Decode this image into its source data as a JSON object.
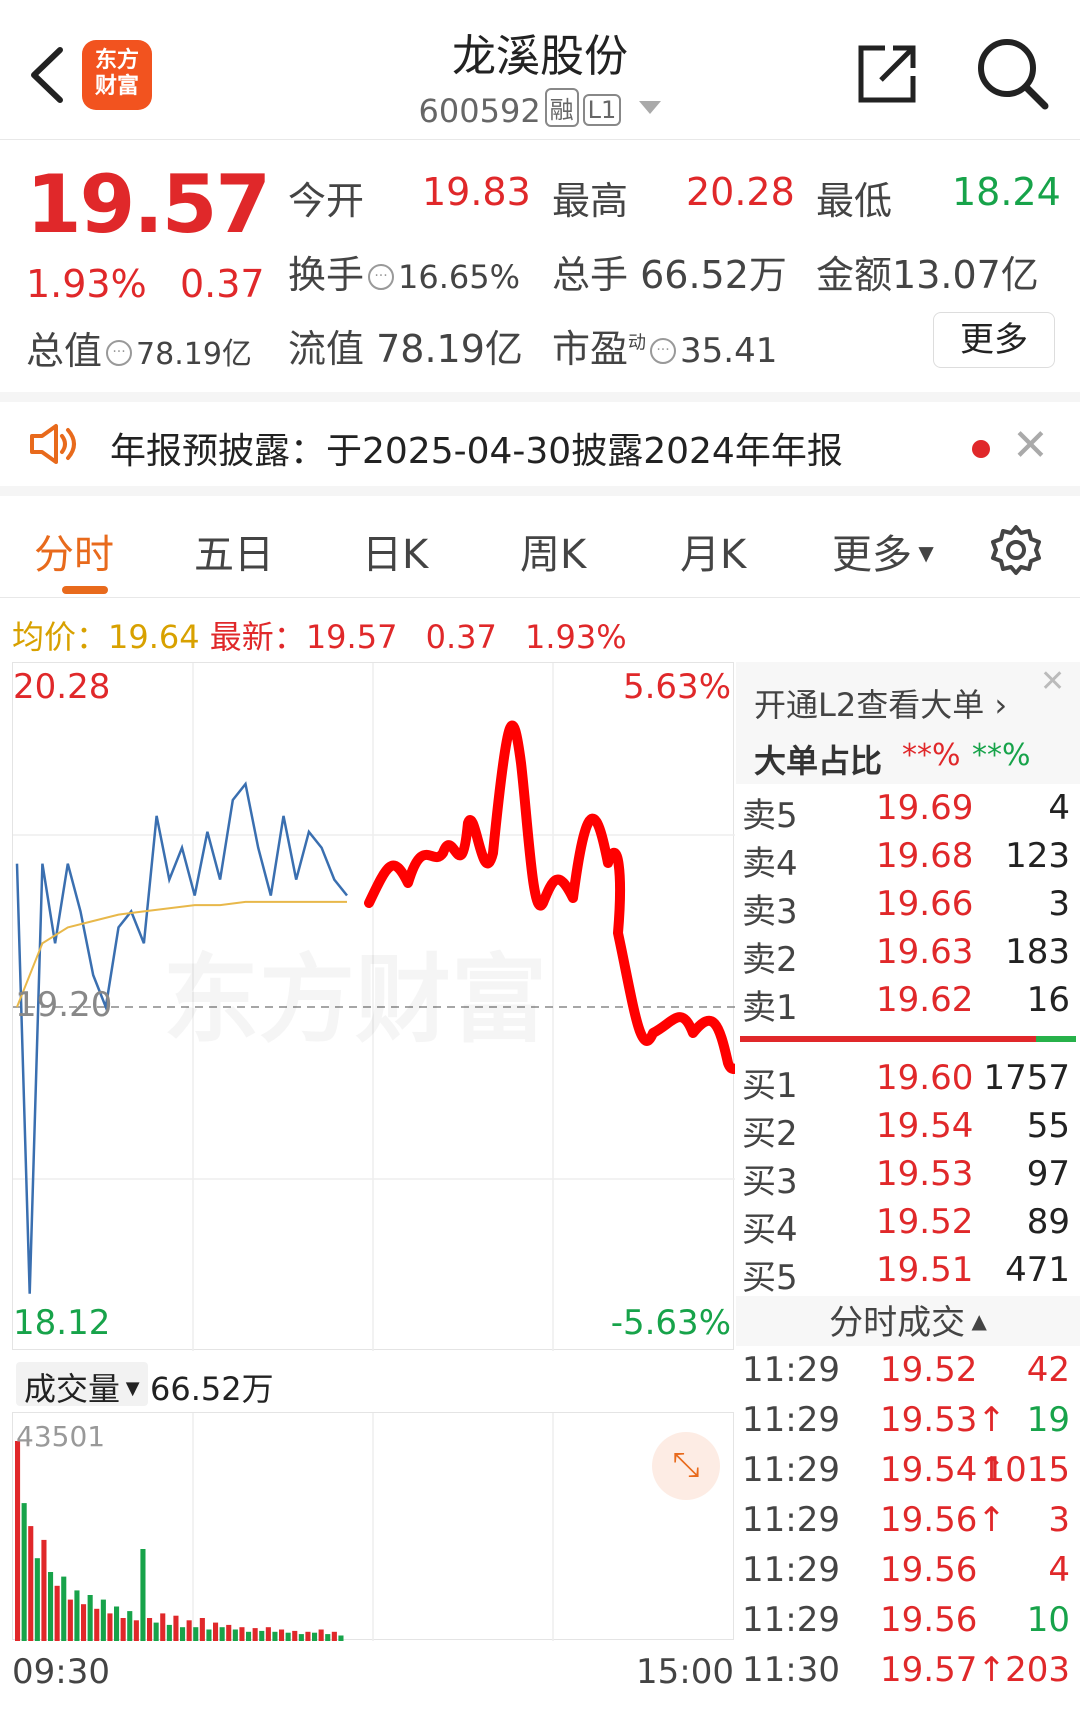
{
  "header": {
    "logo_text": "东方财富",
    "title": "龙溪股份",
    "code": "600592",
    "tag_margin": "融",
    "tag_level": "L1"
  },
  "quote": {
    "price": "19.57",
    "change_pct": "1.93%",
    "change_amt": "0.37",
    "open_label": "今开",
    "open": "19.83",
    "high_label": "最高",
    "high": "20.28",
    "low_label": "最低",
    "low": "18.24",
    "turnover_label": "换手",
    "turnover": "16.65%",
    "volume_label": "总手",
    "volume": "66.52万",
    "amount_label": "金额",
    "amount": "13.07亿",
    "mktcap_label": "总值",
    "mktcap": "78.19亿",
    "float_label": "流值",
    "float": "78.19亿",
    "pe_label": "市盈",
    "pe_sup": "动",
    "pe": "35.41",
    "more": "更多"
  },
  "notice": {
    "text": "年报预披露：于2025-04-30披露2024年年报"
  },
  "tabs": [
    "分时",
    "五日",
    "日K",
    "周K",
    "月K",
    "更多"
  ],
  "avg_row": {
    "avg_label": "均价：",
    "avg": "19.64",
    "latest_label": "最新：",
    "latest": "19.57",
    "chg": "0.37",
    "pct": "1.93%"
  },
  "chart": {
    "y_max": "20.28",
    "y_mid": "19.20",
    "y_min": "18.12",
    "pct_max": "5.63%",
    "pct_min": "-5.63%",
    "vol_label": "成交量",
    "vol_total": "66.52万",
    "vol_max": "43501",
    "t_start": "09:30",
    "t_end": "15:00",
    "watermark": "东方财富"
  },
  "chart_data": {
    "type": "line",
    "title": "",
    "xlabel": "",
    "ylabel": "",
    "ylim": [
      18.12,
      20.28
    ],
    "x_range": [
      "09:30",
      "15:00"
    ],
    "series": [
      {
        "values": [
          19.65,
          18.3,
          19.65,
          19.4,
          19.65,
          19.5,
          19.3,
          19.2,
          19.45,
          19.5,
          19.4,
          19.8,
          19.6,
          19.7,
          19.55,
          19.75,
          19.6,
          19.85,
          19.9,
          19.7,
          19.55,
          19.8,
          19.6,
          19.75,
          19.7,
          19.6,
          19.55
        ]
      },
      {
        "values": [
          19.2,
          19.4,
          19.45,
          19.47,
          19.49,
          19.5,
          19.51,
          19.52,
          19.52,
          19.53,
          19.53,
          19.53,
          19.53,
          19.53
        ]
      }
    ],
    "volume_bars": [
      43501,
      30000,
      25000,
      18000,
      22000,
      15000,
      12000,
      14000,
      9000,
      11000,
      8000,
      10000,
      7000,
      9000,
      6000,
      7500,
      5000,
      6500,
      4500,
      20000,
      5000,
      4000,
      6000,
      3500,
      5500,
      3000,
      4500,
      3000,
      5000,
      2500,
      4000,
      3000,
      3500,
      2500,
      3000,
      2000,
      2800,
      2200,
      3000,
      2000,
      2500,
      1800,
      2200,
      1500,
      2000,
      1800,
      2500,
      1500,
      2000,
      1200
    ]
  },
  "orderbook": {
    "l2_link": "开通L2查看大单",
    "big_order_label": "大单占比",
    "big_order_red": "**%",
    "big_order_green": "**%",
    "asks": [
      {
        "label": "卖5",
        "price": "19.69",
        "vol": "4"
      },
      {
        "label": "卖4",
        "price": "19.68",
        "vol": "123"
      },
      {
        "label": "卖3",
        "price": "19.66",
        "vol": "3"
      },
      {
        "label": "卖2",
        "price": "19.63",
        "vol": "183"
      },
      {
        "label": "卖1",
        "price": "19.62",
        "vol": "16"
      }
    ],
    "bids": [
      {
        "label": "买1",
        "price": "19.60",
        "vol": "1757"
      },
      {
        "label": "买2",
        "price": "19.54",
        "vol": "55"
      },
      {
        "label": "买3",
        "price": "19.53",
        "vol": "97"
      },
      {
        "label": "买4",
        "price": "19.52",
        "vol": "89"
      },
      {
        "label": "买5",
        "price": "19.51",
        "vol": "471"
      }
    ]
  },
  "ticks": {
    "header": "分时成交",
    "rows": [
      {
        "time": "11:29",
        "price": "19.52",
        "arrow": "",
        "vol": "42",
        "color": "#e0282a"
      },
      {
        "time": "11:29",
        "price": "19.53",
        "arrow": "↑",
        "vol": "19",
        "color": "#17a34a"
      },
      {
        "time": "11:29",
        "price": "19.54",
        "arrow": "↑",
        "vol": "1015",
        "color": "#e0282a"
      },
      {
        "time": "11:29",
        "price": "19.56",
        "arrow": "↑",
        "vol": "3",
        "color": "#e0282a"
      },
      {
        "time": "11:29",
        "price": "19.56",
        "arrow": "",
        "vol": "4",
        "color": "#e0282a"
      },
      {
        "time": "11:29",
        "price": "19.56",
        "arrow": "",
        "vol": "10",
        "color": "#17a34a"
      },
      {
        "time": "11:30",
        "price": "19.57",
        "arrow": "↑",
        "vol": "203",
        "color": "#e0282a"
      }
    ]
  },
  "colors": {
    "up": "#e0282a",
    "down": "#17a34a",
    "accent": "#e86a1c",
    "price_line": "#3a6fb0",
    "avg_line": "#e8b84a",
    "annotation": "#ff0000"
  }
}
